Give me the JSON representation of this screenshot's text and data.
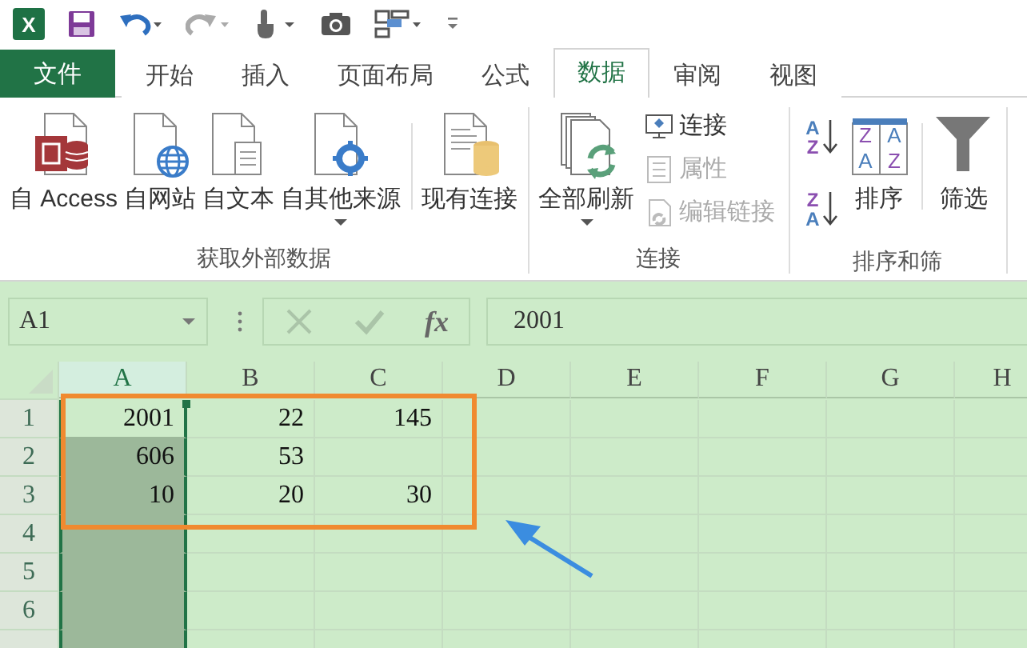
{
  "quick_access": {
    "logo": "X"
  },
  "tabs": [
    {
      "label": "文件",
      "kind": "file",
      "selected": false
    },
    {
      "label": "开始",
      "kind": "tab",
      "selected": false
    },
    {
      "label": "插入",
      "kind": "tab",
      "selected": false
    },
    {
      "label": "页面布局",
      "kind": "tab",
      "selected": false
    },
    {
      "label": "公式",
      "kind": "tab",
      "selected": false
    },
    {
      "label": "数据",
      "kind": "tab",
      "selected": true
    },
    {
      "label": "审阅",
      "kind": "tab",
      "selected": false
    },
    {
      "label": "视图",
      "kind": "tab",
      "selected": false
    }
  ],
  "ribbon": {
    "groups": [
      {
        "label": "获取外部数据",
        "items": [
          {
            "kind": "large",
            "label": "自 Access",
            "dropdown": false
          },
          {
            "kind": "large",
            "label": "自网站",
            "dropdown": false
          },
          {
            "kind": "large",
            "label": "自文本",
            "dropdown": false
          },
          {
            "kind": "large",
            "label": "自其他来源",
            "dropdown": true
          },
          {
            "kind": "separator"
          },
          {
            "kind": "large",
            "label": "现有连接",
            "dropdown": false
          }
        ]
      },
      {
        "label": "连接",
        "items": [
          {
            "kind": "large",
            "label": "全部刷新",
            "dropdown": true
          },
          {
            "kind": "small-stack",
            "items": [
              {
                "label": "连接",
                "disabled": false
              },
              {
                "label": "属性",
                "disabled": true
              },
              {
                "label": "编辑链接",
                "disabled": true
              }
            ]
          }
        ]
      },
      {
        "label": "排序和筛",
        "items": [
          {
            "kind": "sort-stack",
            "items": [
              {
                "letters": [
                  "A",
                  "Z"
                ]
              },
              {
                "letters": [
                  "Z",
                  "A"
                ]
              }
            ]
          },
          {
            "kind": "large",
            "label": "排序",
            "letters": [
              "Z",
              "A",
              "A",
              "Z"
            ],
            "dropdown": false
          },
          {
            "kind": "separator"
          },
          {
            "kind": "large",
            "label": "筛选",
            "dropdown": false
          }
        ]
      }
    ]
  },
  "formula_bar": {
    "name_box": "A1",
    "function_label": "fx",
    "value": "2001"
  },
  "sheet": {
    "columns": [
      {
        "label": "A",
        "selected": true
      },
      {
        "label": "B",
        "selected": false
      },
      {
        "label": "C",
        "selected": false
      },
      {
        "label": "D",
        "selected": false
      },
      {
        "label": "E",
        "selected": false
      },
      {
        "label": "F",
        "selected": false
      },
      {
        "label": "G",
        "selected": false
      },
      {
        "label": "H",
        "selected": false
      }
    ],
    "rows": [
      {
        "label": "1",
        "cells": [
          "2001",
          "22",
          "145"
        ]
      },
      {
        "label": "2",
        "cells": [
          "606",
          "53"
        ]
      },
      {
        "label": "3",
        "cells": [
          "10",
          "20",
          "30"
        ]
      },
      {
        "label": "4"
      },
      {
        "label": "5"
      },
      {
        "label": "6"
      }
    ]
  }
}
